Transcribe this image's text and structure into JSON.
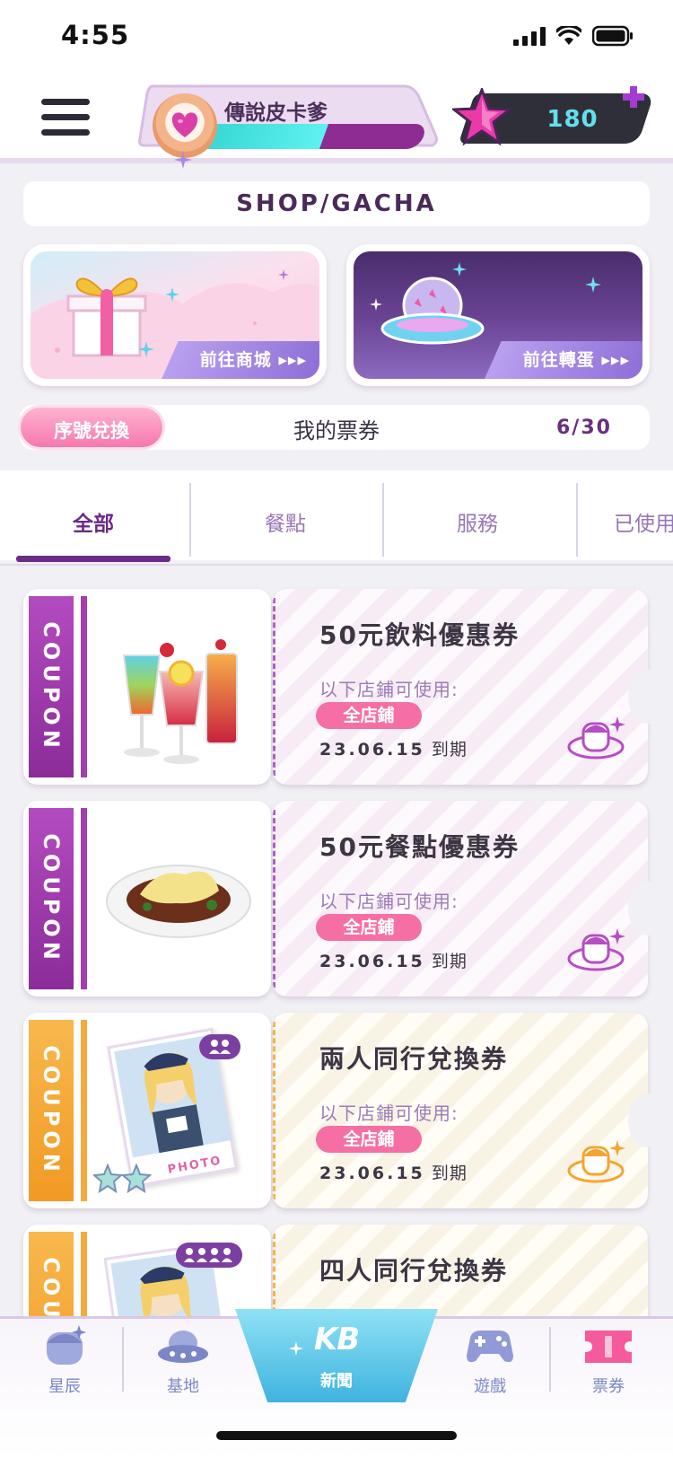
{
  "status_bar": {
    "time": "4:55"
  },
  "header": {
    "user_name": "傳說皮卡爹",
    "exp_progress": 0.55,
    "star_count": "180"
  },
  "shop": {
    "title": "SHOP/GACHA",
    "shop_card_label": "前往商城 ▸▸▸",
    "gacha_card_label": "前往轉蛋 ▸▸▸"
  },
  "tickets": {
    "redeem_label": "序號兌換",
    "my_tickets_label": "我的票券",
    "count": "6/30"
  },
  "tabs": [
    {
      "label": "全部",
      "active": true
    },
    {
      "label": "餐點",
      "active": false
    },
    {
      "label": "服務",
      "active": false
    },
    {
      "label": "已使用",
      "active": false
    }
  ],
  "coupons": [
    {
      "word": "COUPON",
      "title": "50元飲料優惠券",
      "sub": "以下店鋪可使用:",
      "store": "全店鋪",
      "date": "23.06.15",
      "expire_suffix": "到期",
      "theme": "purple"
    },
    {
      "word": "COUPON",
      "title": "50元餐點優惠券",
      "sub": "以下店鋪可使用:",
      "store": "全店鋪",
      "date": "23.06.15",
      "expire_suffix": "到期",
      "theme": "purple"
    },
    {
      "word": "COUPON",
      "title": "兩人同行兌換券",
      "sub": "以下店鋪可使用:",
      "store": "全店鋪",
      "date": "23.06.15",
      "expire_suffix": "到期",
      "theme": "orange",
      "photo_label": "PHOTO"
    },
    {
      "word": "COUPON",
      "title": "四人同行兌換券",
      "theme": "orange"
    }
  ],
  "bottom_nav": {
    "items": [
      {
        "label": "星辰",
        "icon": "star-character-icon"
      },
      {
        "label": "基地",
        "icon": "ufo-icon"
      },
      {
        "label": "遊戲",
        "icon": "gamepad-icon"
      },
      {
        "label": "票券",
        "icon": "ticket-icon"
      }
    ],
    "center_logo": "KB",
    "center_label": "新聞"
  },
  "colors": {
    "purple_coupon": "#a23fae",
    "orange_coupon": "#f4aa3c",
    "accent_pink": "#f56fa4",
    "tab_active": "#6c2a86"
  }
}
